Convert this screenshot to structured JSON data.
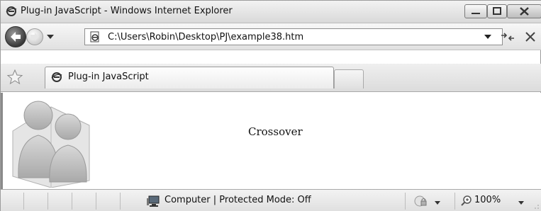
{
  "window": {
    "title": "Plug-in JavaScript - Windows Internet Explorer",
    "icon": "ie-logo-icon",
    "controls": [
      "minimize-icon",
      "maximize-icon",
      "close-icon"
    ]
  },
  "navigation": {
    "back_icon": "back-arrow-icon",
    "forward_icon": "forward-arrow-icon",
    "address": {
      "value": "C:\\Users\\Robin\\Desktop\\PJ\\example38.htm",
      "icon": "page-icon"
    },
    "refresh_icon": "refresh-icon",
    "stop_icon": "stop-icon"
  },
  "tabs": {
    "favorites_icon": "star-icon",
    "items": [
      {
        "label": "Plug-in JavaScript",
        "icon": "ie-logo-icon"
      }
    ]
  },
  "page": {
    "image_icon": "users-icon",
    "text": "Crossover"
  },
  "status": {
    "zone_icon": "computer-icon",
    "zone_text": "Computer | Protected Mode: Off",
    "security_icon": "lock-icon",
    "zoom_text": "100%",
    "zoom_icon": "magnifier-icon"
  }
}
